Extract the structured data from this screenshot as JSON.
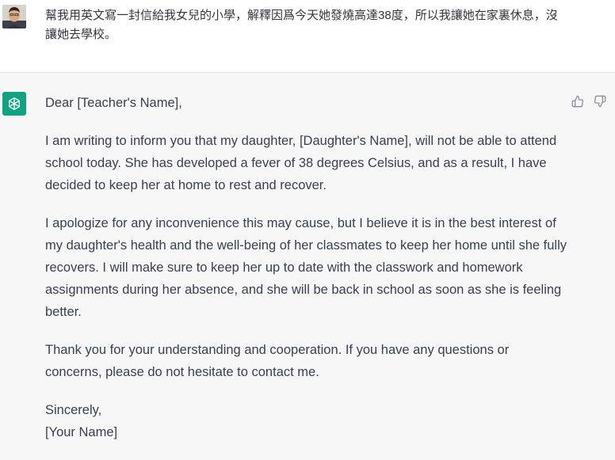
{
  "user_message": {
    "text": "幫我用英文寫一封信給我女兒的小學，解釋因爲今天她發燒高達38度，所以我讓她在家裏休息，沒讓她去學校。"
  },
  "assistant_message": {
    "salutation": "Dear [Teacher's Name],",
    "paragraphs": [
      "I am writing to inform you that my daughter, [Daughter's Name], will not be able to attend school today. She has developed a fever of 38 degrees Celsius, and as a result, I have decided to keep her at home to rest and recover.",
      "I apologize for any inconvenience this may cause, but I believe it is in the best interest of my daughter's health and the well-being of her classmates to keep her home until she fully recovers. I will make sure to keep her up to date with the classwork and homework assignments during her absence, and she will be back in school as soon as she is feeling better.",
      "Thank you for your understanding and cooperation. If you have any questions or concerns, please do not hesitate to contact me."
    ],
    "closing": "Sincerely,",
    "signature": "[Your Name]"
  },
  "icons": {
    "user_avatar": "user-avatar-photo",
    "assistant_avatar": "openai-logo-icon",
    "thumbs_up": "thumbs-up-icon",
    "thumbs_down": "thumbs-down-icon"
  },
  "colors": {
    "assistant_avatar_bg": "#10a37f",
    "assistant_bg": "#f7f7f8",
    "text": "#374151"
  }
}
